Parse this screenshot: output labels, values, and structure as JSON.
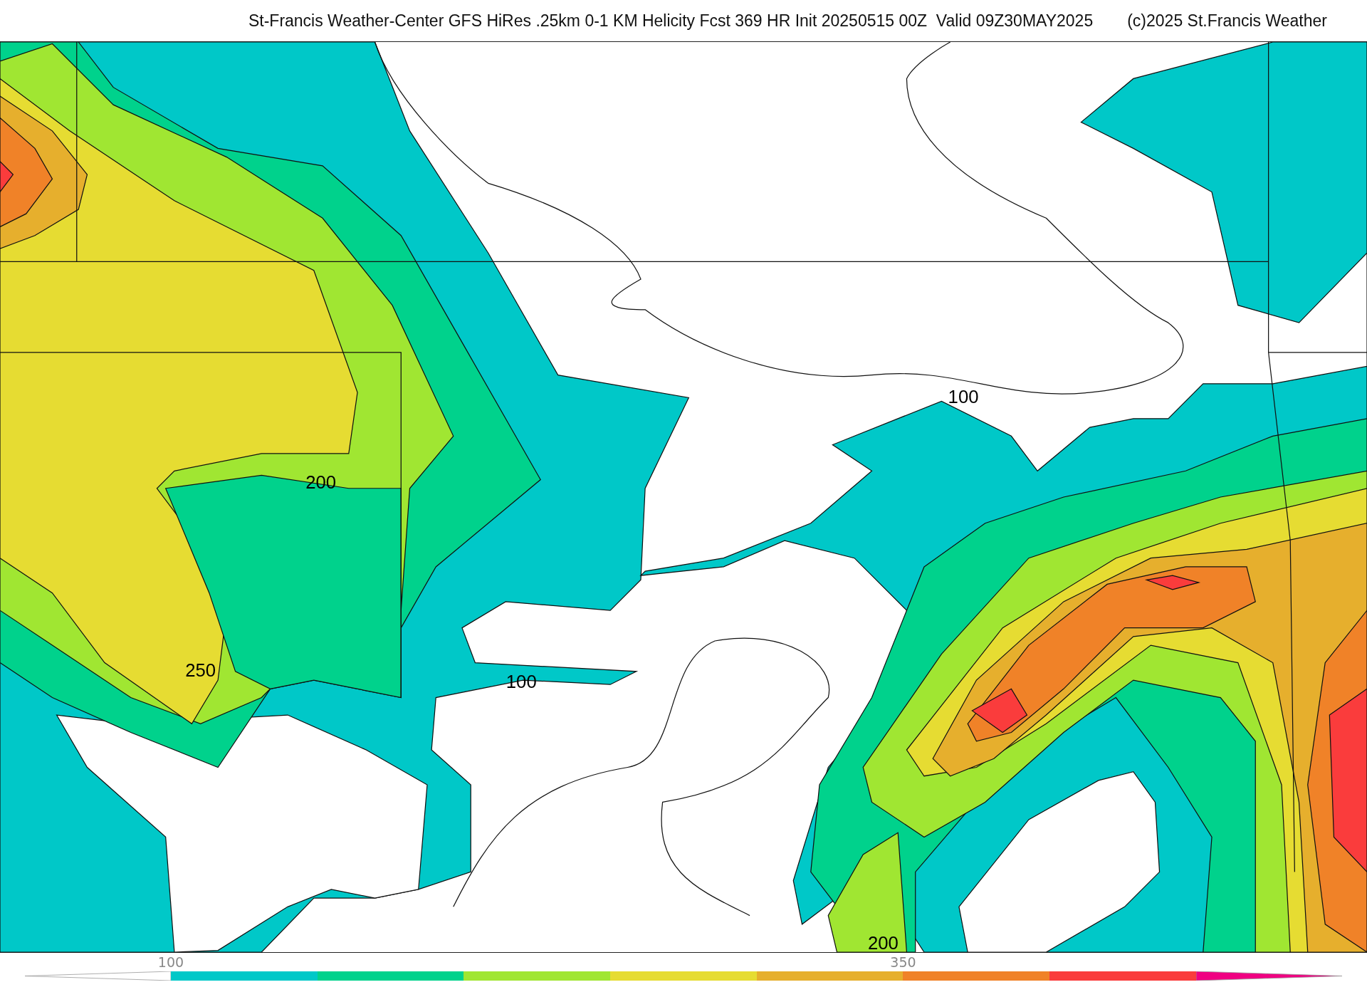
{
  "title": "St-Francis Weather-Center GFS HiRes .25km 0-1 KM Helicity Fcst 369 HR Init 20250515 00Z  Valid 09Z30MAY2025",
  "credit": "(c)2025 St.Francis Weather",
  "map": {
    "contour_labels": [
      {
        "text": "100"
      },
      {
        "text": "200"
      },
      {
        "text": "250"
      },
      {
        "text": "100"
      },
      {
        "text": "200"
      }
    ]
  },
  "colorbar": {
    "segments": [
      {
        "color": "#00c8c8",
        "tick_label": "100"
      },
      {
        "color": "#00d28c"
      },
      {
        "color": "#a0e632"
      },
      {
        "color": "#e6dc32"
      },
      {
        "color": "#e6af2d"
      },
      {
        "color": "#f08228",
        "tick_label": "350"
      },
      {
        "color": "#fa3c3c"
      },
      {
        "color": "#f00082",
        "kind": "end_arrow"
      }
    ]
  }
}
